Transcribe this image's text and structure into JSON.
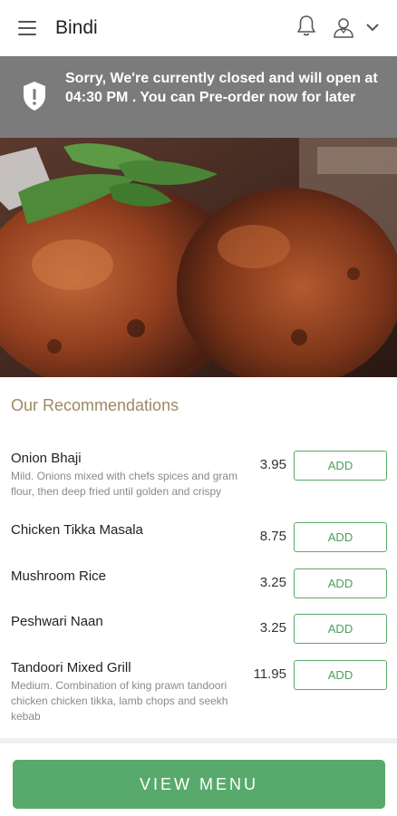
{
  "header": {
    "title": "Bindi",
    "icons": [
      "hamburger-menu-icon",
      "bell-icon",
      "user-icon",
      "chevron-down-icon"
    ]
  },
  "notice": {
    "text": "Sorry, We're currently closed and will open at 04:30 PM . You can Pre-order now for later",
    "icon": "shield-alert-icon",
    "background": "#7b7b7b"
  },
  "hero": {
    "icon": "tandoori-chicken-photo"
  },
  "recommendations": {
    "title": "Our Recommendations",
    "items": [
      {
        "name": "Onion Bhaji",
        "description": "Mild. Onions mixed with chefs spices and gram flour, then deep fried until golden and crispy",
        "price": "3.95",
        "add_label": "ADD"
      },
      {
        "name": "Chicken Tikka Masala",
        "description": "",
        "price": "8.75",
        "add_label": "ADD"
      },
      {
        "name": "Mushroom Rice",
        "description": "",
        "price": "3.25",
        "add_label": "ADD"
      },
      {
        "name": "Peshwari Naan",
        "description": "",
        "price": "3.25",
        "add_label": "ADD"
      },
      {
        "name": "Tandoori Mixed Grill",
        "description": "Medium. Combination of king prawn tandoori chicken chicken tikka, lamb chops and seekh kebab",
        "price": "11.95",
        "add_label": "ADD"
      }
    ]
  },
  "footer": {
    "view_menu_label": "VIEW MENU"
  },
  "colors": {
    "accent": "#58aa6c",
    "section_title": "#9d8a64",
    "notice_bg": "#7b7b7b"
  }
}
